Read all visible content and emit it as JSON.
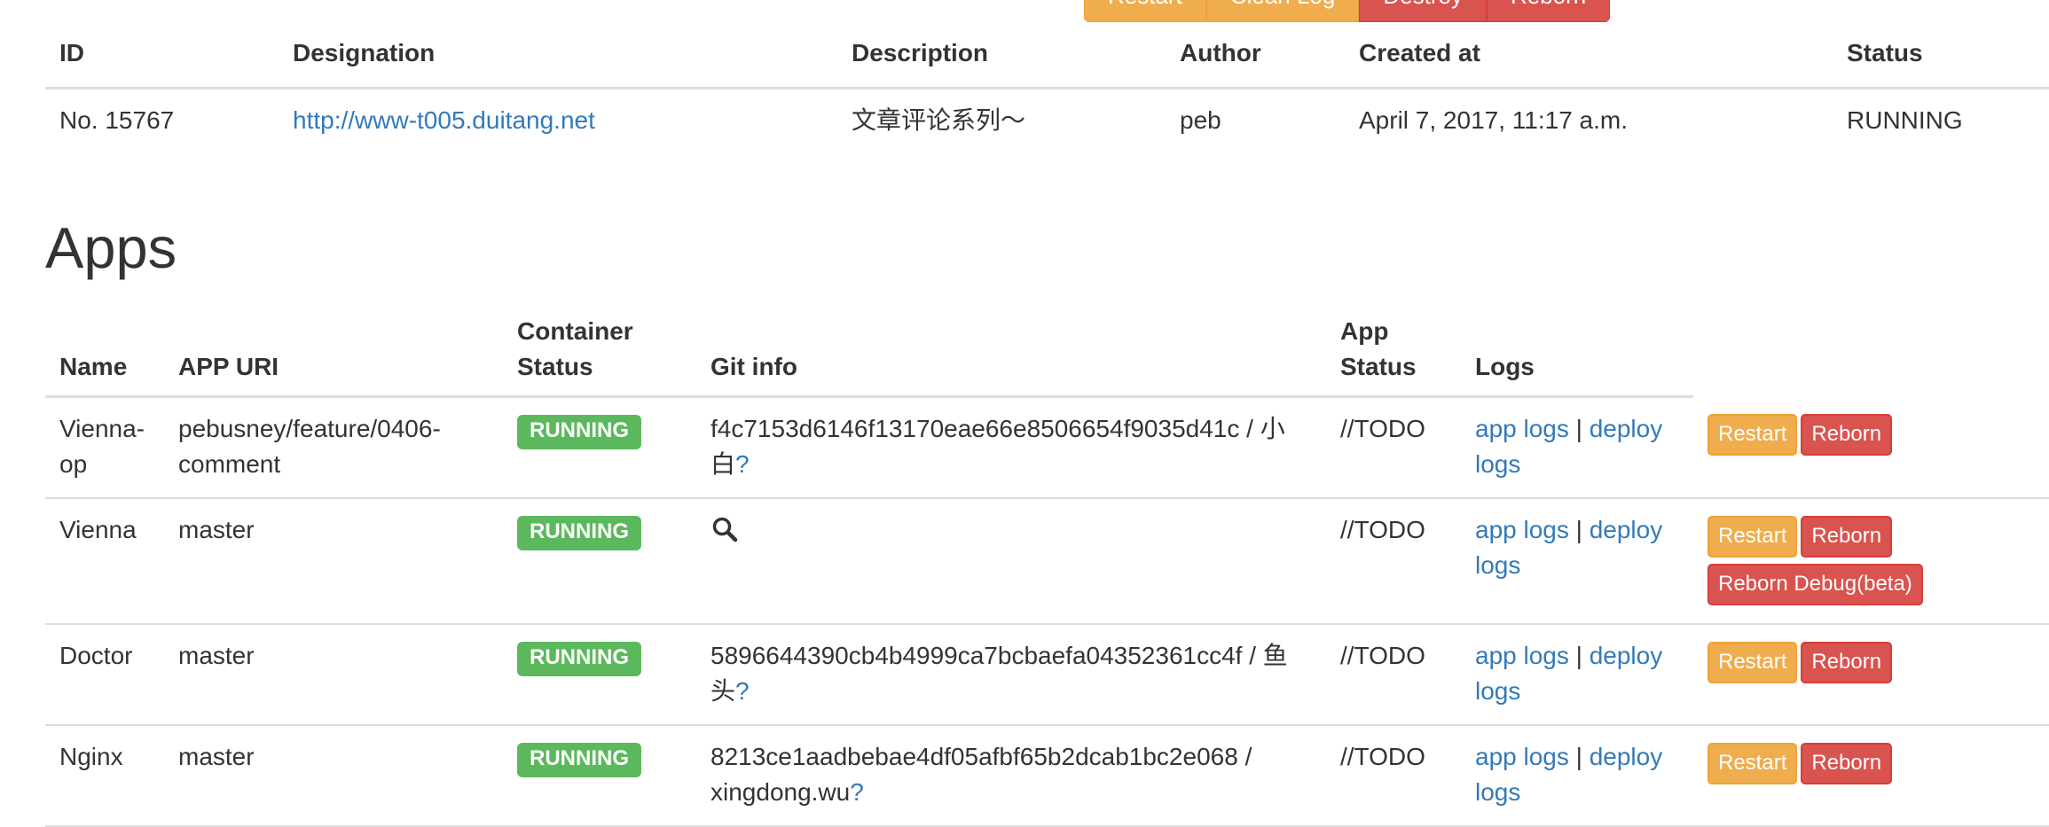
{
  "top_actions": [
    {
      "label": "Restart",
      "color": "#f0ad4e"
    },
    {
      "label": "Clean Log",
      "color": "#f0ad4e"
    },
    {
      "label": "Destroy",
      "color": "#d9534f"
    },
    {
      "label": "Reborn",
      "color": "#d9534f"
    }
  ],
  "project": {
    "headers": [
      "ID",
      "Designation",
      "Description",
      "Author",
      "Created at",
      "Status"
    ],
    "id": "No. 15767",
    "designation": "http://www-t005.duitang.net",
    "description": "文章评论系列～",
    "author": "peb",
    "created_at": "April 7, 2017, 11:17 a.m.",
    "status": "RUNNING"
  },
  "apps": {
    "title": "Apps",
    "headers": {
      "name": "Name",
      "uri": "APP URI",
      "container_status_1": "Container",
      "container_status_2": "Status",
      "git": "Git info",
      "app_status_1": "App",
      "app_status_2": "Status",
      "logs": "Logs"
    },
    "rows": [
      {
        "name": "Vienna-op",
        "uri": "pebusney/feature/0406-comment",
        "container_status": "RUNNING",
        "git": "f4c7153d6146f13170eae66e8506654f9035d41c / 小白",
        "git_q": "?",
        "app_status": "//TODO",
        "app_logs": "app logs",
        "sep": "|",
        "deploy_logs": "deploy logs",
        "restart": "Restart",
        "reborn": "Reborn"
      },
      {
        "name": "Vienna",
        "uri": "master",
        "container_status": "RUNNING",
        "git_icon": "search-icon",
        "app_status": "//TODO",
        "app_logs": "app logs",
        "sep": "|",
        "deploy_logs": "deploy logs",
        "restart": "Restart",
        "reborn": "Reborn",
        "reborn_debug": "Reborn Debug(beta)"
      },
      {
        "name": "Doctor",
        "uri": "master",
        "container_status": "RUNNING",
        "git": "5896644390cb4b4999ca7bcbaefa04352361cc4f / 鱼头",
        "git_q": "?",
        "app_status": "//TODO",
        "app_logs": "app logs",
        "sep": "|",
        "deploy_logs": "deploy logs",
        "restart": "Restart",
        "reborn": "Reborn"
      },
      {
        "name": "Nginx",
        "uri": "master",
        "container_status": "RUNNING",
        "git": "8213ce1aadbebae4df05afbf65b2dcab1bc2e068 / xingdong.wu",
        "git_q": "?",
        "app_status": "//TODO",
        "app_logs": "app logs",
        "sep": "|",
        "deploy_logs": "deploy logs",
        "restart": "Restart",
        "reborn": "Reborn"
      }
    ]
  },
  "colors": {
    "link": "#337ab7",
    "success": "#5cb85c",
    "warning": "#f0ad4e",
    "danger": "#d9534f"
  }
}
